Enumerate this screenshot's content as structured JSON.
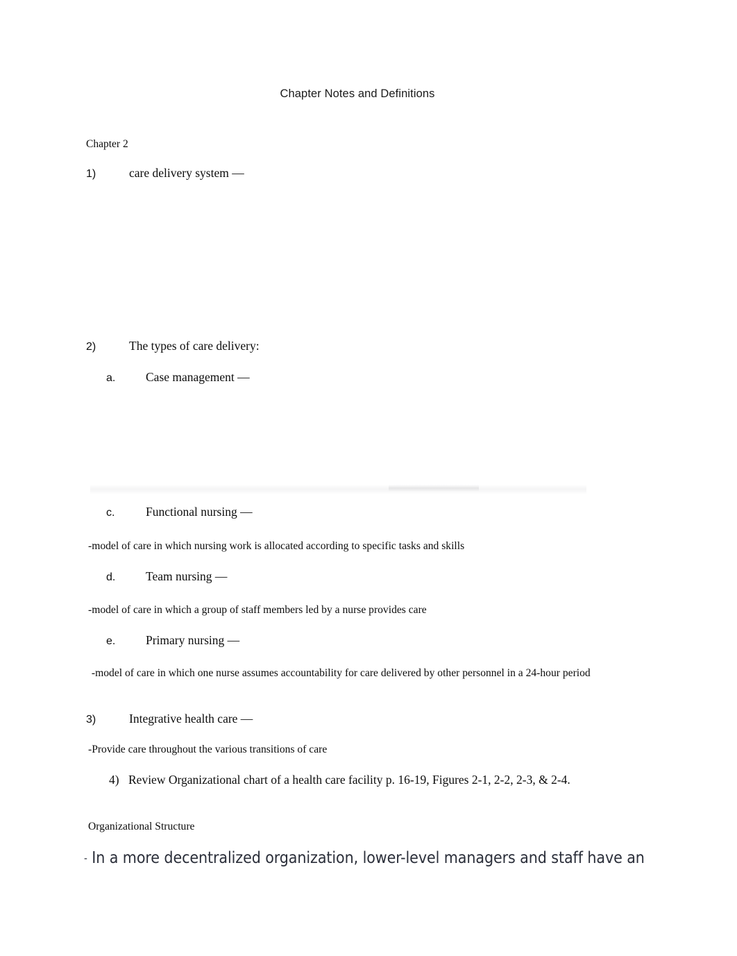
{
  "document": {
    "title": "Chapter Notes and Definitions",
    "chapter_label": "Chapter 2"
  },
  "outline": {
    "item1": {
      "marker": "1)",
      "text": "care delivery system —"
    },
    "item2": {
      "marker": "2)",
      "text": "The types of care delivery:",
      "sub": {
        "a": {
          "marker": "a.",
          "text": "Case management —",
          "definition": ""
        },
        "c": {
          "marker": "c.",
          "text": "Functional nursing —",
          "definition": "-model of care in which nursing work is allocated according to specific tasks and skills"
        },
        "d": {
          "marker": "d.",
          "text": "Team nursing —",
          "definition": "-model of care in which a group of staff members led by a nurse provides care"
        },
        "e": {
          "marker": "e.",
          "text": "Primary nursing —",
          "definition": " -model of care in which one nurse assumes accountability for care delivered by other personnel in a 24-hour period"
        }
      }
    },
    "item3": {
      "marker": "3)",
      "text": "Integrative health care —",
      "definition": "-Provide care throughout the various transitions of care"
    },
    "item4": {
      "marker": "4)",
      "text": "Review Organizational chart of a health care facility p. 16-19, Figures 2-1, 2-2, 2-3, & 2-4."
    }
  },
  "sections": {
    "organizational_structure_heading": "Organizational Structure",
    "organizational_structure_note_dash": "-",
    "organizational_structure_note": "In a more decentralized organization, lower-level managers and staff have an"
  },
  "colors": {
    "page_background": "#ffffff",
    "body_text": "#0d0d0d",
    "title_text": "#1a1a1a",
    "note_text": "#2b2f3a"
  }
}
